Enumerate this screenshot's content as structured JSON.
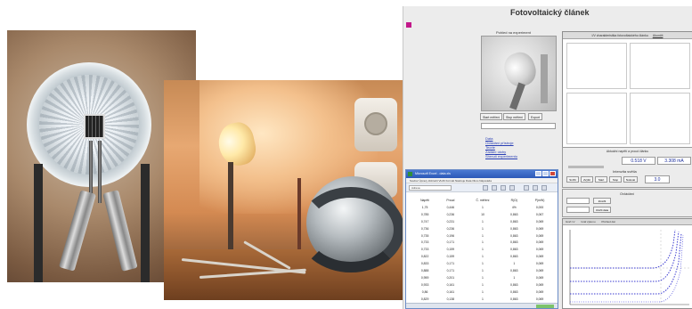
{
  "app": {
    "title": "Fotovoltaický článek",
    "camera_panel_title": "Pohled na experiment",
    "graph_title": "I/V charakteristika fotovoltaického článku",
    "graph_mode": "Ukončit",
    "buttons": [
      "Start měření",
      "Stop měření",
      "Export"
    ],
    "links": [
      "Data",
      "Ovládání přístroje",
      "Teorie",
      "Zadání úlohy",
      "Shrnutí experimentu"
    ]
  },
  "measurement": {
    "panel_title": "Aktuální napětí a proud článku",
    "voltage": "0.518 V",
    "current": "3.308 mA",
    "intensity_label": "Intenzita světla",
    "intensity_value": "3.0",
    "buttons": [
      "Snížit",
      "Zvýšit",
      "Start",
      "Stop",
      "Nulovat"
    ]
  },
  "controls": {
    "title": "Ovládání",
    "buttons": [
      "Změřit",
      "Uložit data"
    ]
  },
  "iv_graph": {
    "tabs": [
      "Graf I-V",
      "Graf výkonu",
      "Přehled dat"
    ]
  },
  "excel": {
    "title": "Microsoft Excel - data.xls",
    "menubar": "Soubor  Úpravy  Zobrazit  Vložit  Formát  Nástroje  Data  Okno  Nápověda",
    "address": "Adresa",
    "columns": [
      "Napětí",
      "Proud",
      "Č. měření",
      "R(Ω)",
      "P(mW)"
    ],
    "rows": [
      [
        "1,75",
        "0,446",
        "1",
        "4%",
        "0,000"
      ],
      [
        "0,785",
        "0,236",
        "10",
        "0,863",
        "0,067"
      ],
      [
        "0,747",
        "0,231",
        "1",
        "0,863",
        "0,069"
      ],
      [
        "0,736",
        "0,236",
        "1",
        "0,863",
        "0,069"
      ],
      [
        "0,735",
        "0,196",
        "1",
        "0,863",
        "0,069"
      ],
      [
        "0,733",
        "0,171",
        "1",
        "0,863",
        "0,069"
      ],
      [
        "0,733",
        "0,159",
        "1",
        "0,863",
        "0,069"
      ],
      [
        "0,822",
        "0,159",
        "1",
        "0,863",
        "0,069"
      ],
      [
        "0,833",
        "0,171",
        "1",
        "1",
        "0,069"
      ],
      [
        "0,888",
        "0,171",
        "1",
        "0,863",
        "0,069"
      ],
      [
        "0,959",
        "0,201",
        "1",
        "1",
        "0,069"
      ],
      [
        "0,933",
        "0,161",
        "1",
        "0,863",
        "0,069"
      ],
      [
        "0,86",
        "0,161",
        "1",
        "0,863",
        "0,069"
      ],
      [
        "0,829",
        "0,138",
        "1",
        "0,863",
        "0,069"
      ]
    ]
  }
}
